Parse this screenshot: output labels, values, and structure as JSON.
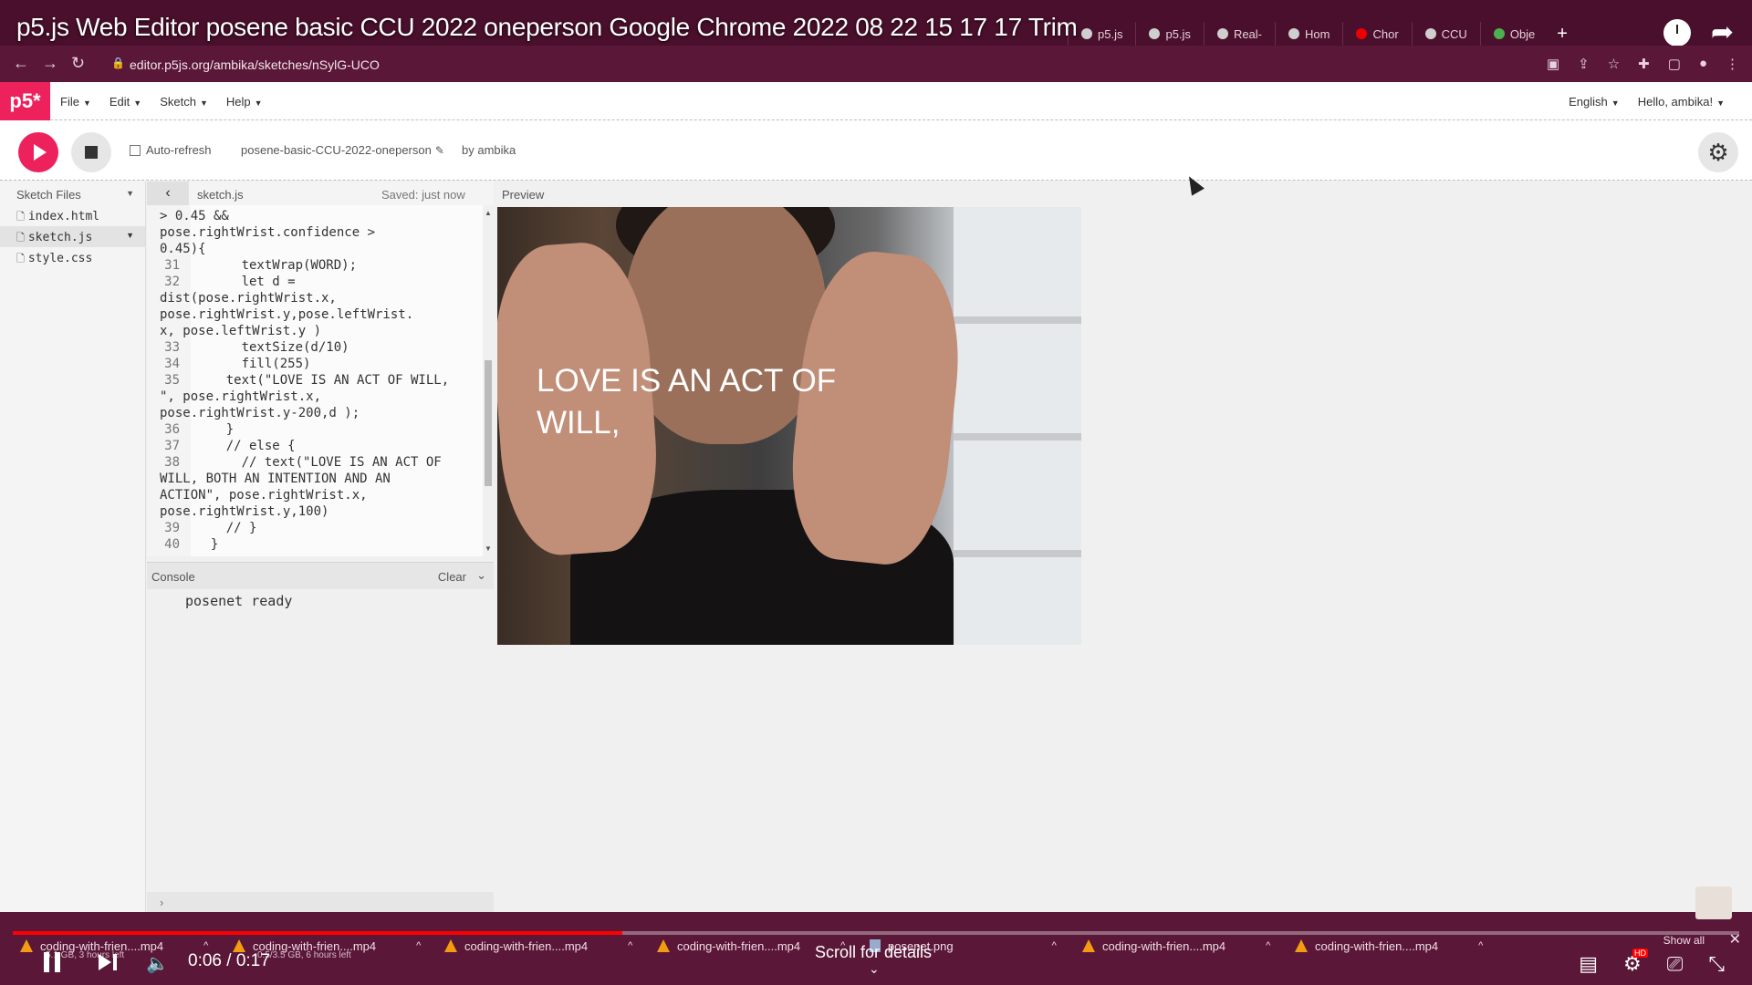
{
  "video": {
    "title": "p5.js Web Editor posene basic CCU 2022 oneperson Google Chrome 2022 08 22 15 17 17 Trim",
    "time": "0:06 / 0:17",
    "progress": 0.353,
    "scroll_hint": "Scroll for details"
  },
  "browser": {
    "tabs": [
      {
        "label": "p5.js"
      },
      {
        "label": "p5.js"
      },
      {
        "label": "Real-"
      },
      {
        "label": "Hom"
      },
      {
        "label": "Chor"
      },
      {
        "label": "CCU"
      },
      {
        "label": "Obje"
      }
    ],
    "url": "editor.p5js.org/ambika/sketches/nSylG-UCO"
  },
  "nav": {
    "logo": "p5*",
    "menus": [
      {
        "label": "File"
      },
      {
        "label": "Edit"
      },
      {
        "label": "Sketch"
      },
      {
        "label": "Help"
      }
    ],
    "language": "English",
    "user": "Hello, ambika!"
  },
  "toolbar": {
    "auto_refresh": "Auto-refresh",
    "sketch_name": "posene-basic-CCU-2022-oneperson",
    "author": "by ambika"
  },
  "sidebar": {
    "title": "Sketch Files",
    "files": [
      {
        "name": "index.html"
      },
      {
        "name": "sketch.js"
      },
      {
        "name": "style.css"
      }
    ]
  },
  "editor": {
    "tab": "sketch.js",
    "saved": "Saved: just now",
    "lines": [
      {
        "n": "",
        "text": "> 0.45 &&"
      },
      {
        "n": "",
        "text": "pose.rightWrist.confidence >"
      },
      {
        "n": "",
        "text": "0.45){"
      },
      {
        "n": "31",
        "text": "      textWrap(WORD);"
      },
      {
        "n": "32",
        "text": "      let d ="
      },
      {
        "n": "",
        "text": "dist(pose.rightWrist.x,"
      },
      {
        "n": "",
        "text": "pose.rightWrist.y,pose.leftWrist."
      },
      {
        "n": "",
        "text": "x, pose.leftWrist.y )"
      },
      {
        "n": "33",
        "text": "      textSize(d/10)"
      },
      {
        "n": "34",
        "text": "      fill(255)"
      },
      {
        "n": "35",
        "text": "    text(\"LOVE IS AN ACT OF WILL,"
      },
      {
        "n": "",
        "text": "\", pose.rightWrist.x,"
      },
      {
        "n": "",
        "text": "pose.rightWrist.y-200,d );"
      },
      {
        "n": "36",
        "text": "    }"
      },
      {
        "n": "37",
        "text": "    // else {"
      },
      {
        "n": "38",
        "text": "      // text(\"LOVE IS AN ACT OF"
      },
      {
        "n": "",
        "text": "WILL, BOTH AN INTENTION AND AN"
      },
      {
        "n": "",
        "text": "ACTION\", pose.rightWrist.x,"
      },
      {
        "n": "",
        "text": "pose.rightWrist.y,100)"
      },
      {
        "n": "39",
        "text": "    // }"
      },
      {
        "n": "40",
        "text": "  }"
      }
    ]
  },
  "console": {
    "title": "Console",
    "clear": "Clear",
    "message": "posenet ready"
  },
  "preview": {
    "label": "Preview",
    "overlay_text": "LOVE IS AN ACT OF WILL,"
  },
  "downloads": [
    {
      "name": "coding-with-frien....mp4",
      "sub": "5.1 GB, 3 hours left"
    },
    {
      "name": "coding-with-frien....mp4",
      "sub": "0.5/3.5 GB, 6 hours left"
    },
    {
      "name": "coding-with-frien....mp4",
      "sub": ""
    },
    {
      "name": "coding-with-frien....mp4",
      "sub": ""
    },
    {
      "name": "posenet.png",
      "sub": ""
    },
    {
      "name": "coding-with-frien....mp4",
      "sub": ""
    },
    {
      "name": "coding-with-frien....mp4",
      "sub": ""
    }
  ],
  "show_all": "Show all",
  "colors": {
    "brand": "#ed225d",
    "progress": "#ff0000",
    "chrome": "#5a1738"
  }
}
